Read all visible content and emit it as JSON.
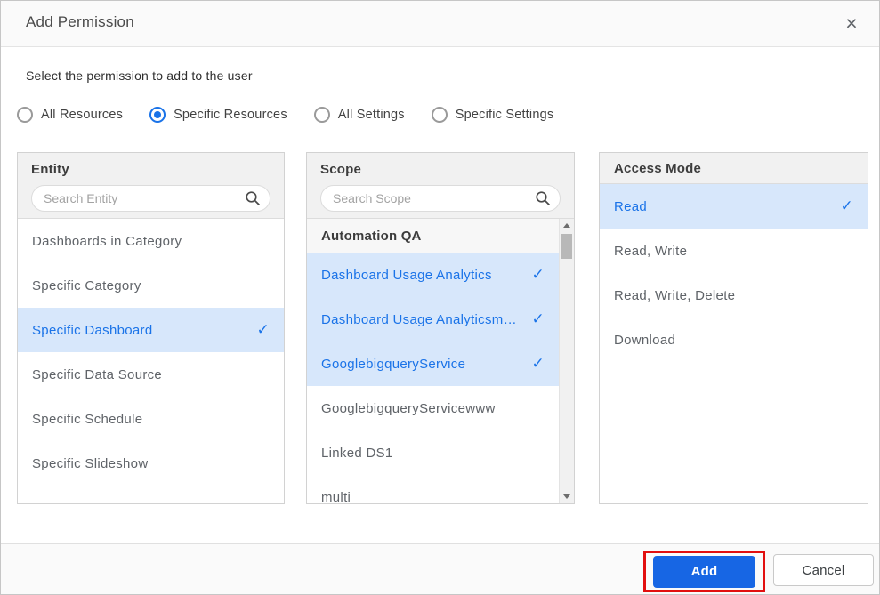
{
  "dialog": {
    "title": "Add Permission",
    "subtitle": "Select the permission to add to the user"
  },
  "icons": {
    "close": "×",
    "check": "✓"
  },
  "radio_group": {
    "options": [
      {
        "label": "All Resources",
        "selected": false
      },
      {
        "label": "Specific Resources",
        "selected": true
      },
      {
        "label": "All Settings",
        "selected": false
      },
      {
        "label": "Specific Settings",
        "selected": false
      }
    ]
  },
  "panels": {
    "entity": {
      "title": "Entity",
      "search_placeholder": "Search Entity",
      "items": [
        {
          "label": "Dashboards in Category",
          "selected": false
        },
        {
          "label": "Specific Category",
          "selected": false
        },
        {
          "label": "Specific Dashboard",
          "selected": true
        },
        {
          "label": "Specific Data Source",
          "selected": false
        },
        {
          "label": "Specific Schedule",
          "selected": false
        },
        {
          "label": "Specific Slideshow",
          "selected": false
        }
      ]
    },
    "scope": {
      "title": "Scope",
      "search_placeholder": "Search Scope",
      "group_header": "Automation QA",
      "items": [
        {
          "label": "Dashboard Usage Analytics",
          "selected": true
        },
        {
          "label": "Dashboard Usage Analyticsm…",
          "selected": true
        },
        {
          "label": "GooglebigqueryService",
          "selected": true
        },
        {
          "label": "GooglebigqueryServicewww",
          "selected": false
        },
        {
          "label": "Linked DS1",
          "selected": false
        },
        {
          "label": "multi",
          "selected": false
        }
      ]
    },
    "access_mode": {
      "title": "Access Mode",
      "items": [
        {
          "label": "Read",
          "selected": true
        },
        {
          "label": "Read, Write",
          "selected": false
        },
        {
          "label": "Read, Write, Delete",
          "selected": false
        },
        {
          "label": "Download",
          "selected": false
        }
      ]
    }
  },
  "footer": {
    "add_label": "Add",
    "cancel_label": "Cancel"
  },
  "colors": {
    "accent_blue": "#1a73e8",
    "selection_bg": "#d7e7fb",
    "add_button_bg": "#1766e4",
    "annotation_red": "#e20f0f",
    "panel_header_bg": "#f1f1f1",
    "header_footer_bg": "#fafafa"
  }
}
